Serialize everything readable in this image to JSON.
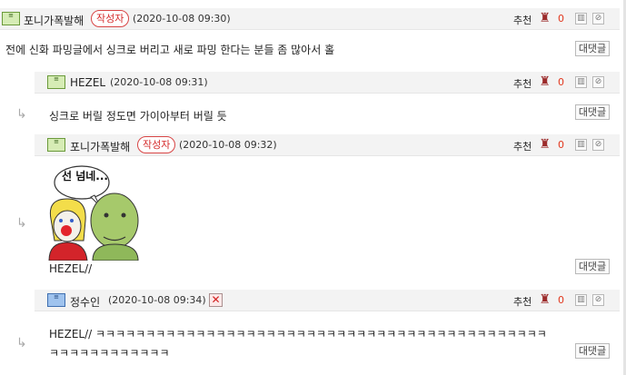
{
  "common": {
    "recommend_label": "추천",
    "recommend_count": "0",
    "reply_button_label": "대댓글",
    "author_badge_label": "작성자"
  },
  "comments": [
    {
      "nickname": "포니가폭발해",
      "date": "(2020-10-08 09:30)",
      "text": "전에 신화 파밍글에서 싱크로 버리고 새로 파밍 한다는 분들 좀 많아서 홀"
    },
    {
      "nickname": "HEZEL",
      "date": "(2020-10-08 09:31)",
      "text": "싱크로 버릴 정도면 가이아부터 버릴 듯"
    },
    {
      "nickname": "포니가폭발해",
      "date": "(2020-10-08 09:32)",
      "image_text": "선 넘네...",
      "text": "HEZEL//"
    },
    {
      "nickname": "정수인",
      "date": "(2020-10-08 09:34)",
      "text_line1": "HEZEL// ㅋㅋㅋㅋㅋㅋㅋㅋㅋㅋㅋㅋㅋㅋㅋㅋㅋㅋㅋㅋㅋㅋㅋㅋㅋㅋㅋㅋㅋㅋㅋㅋㅋㅋㅋㅋㅋㅋㅋㅋㅋㅋㅋㅋㅋ",
      "text_line2": "ㅋㅋㅋㅋㅋㅋㅋㅋㅋㅋㅋㅋ"
    }
  ]
}
